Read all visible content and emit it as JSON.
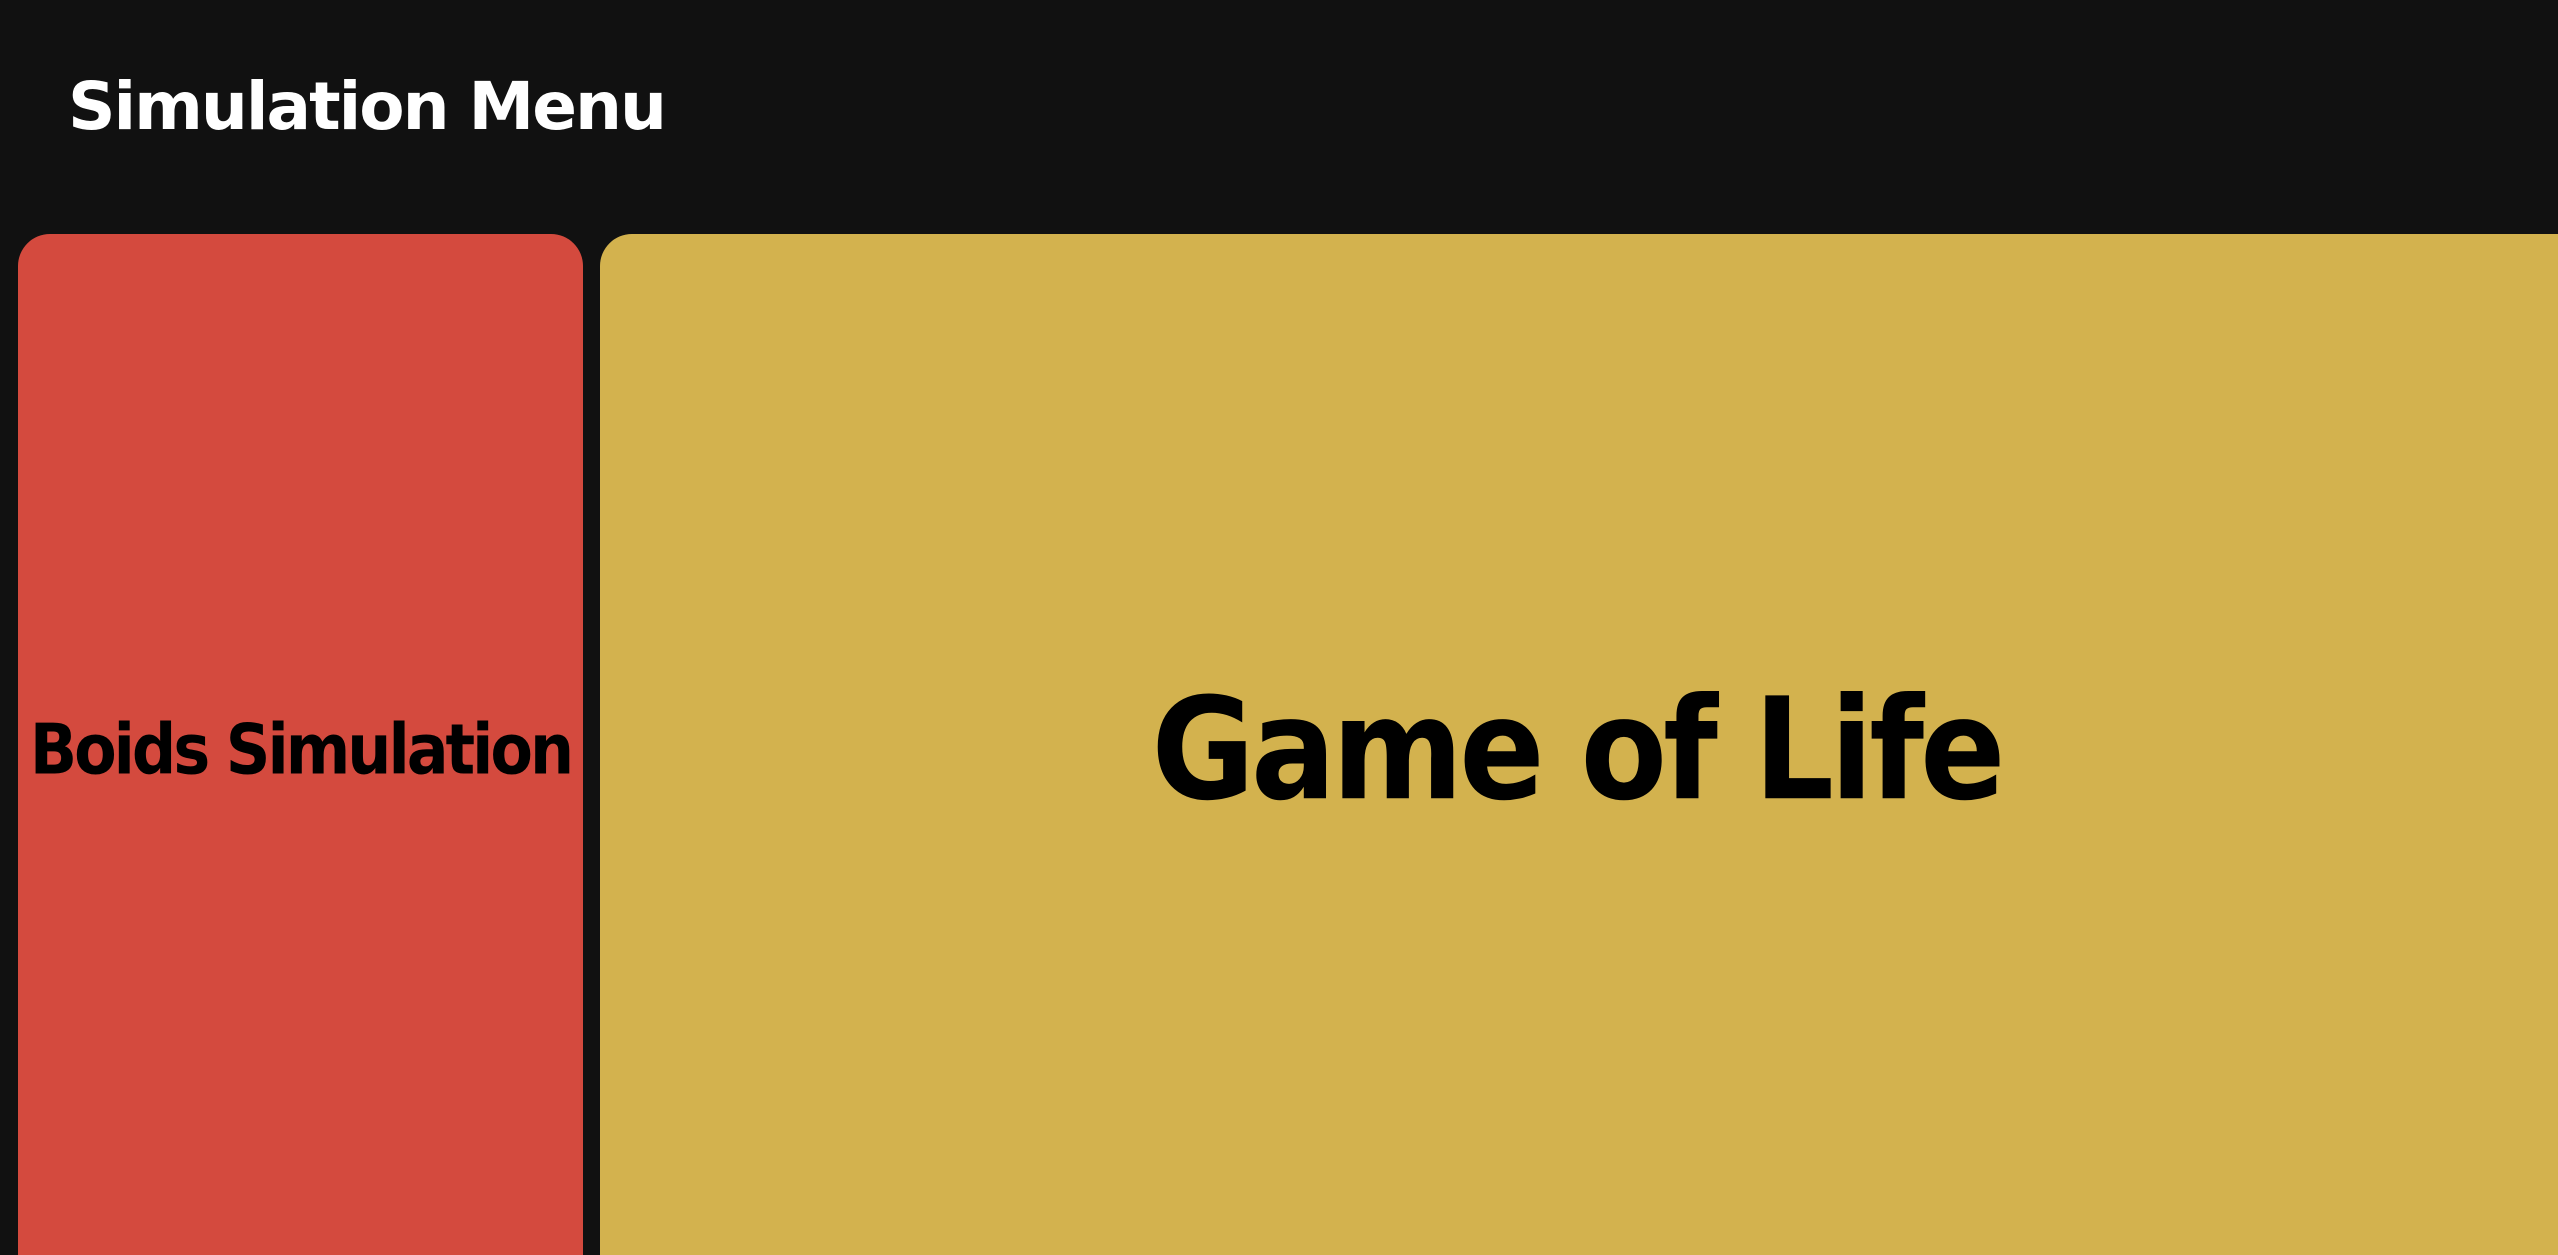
{
  "header": {
    "title": "Simulation Menu"
  },
  "simulations": [
    {
      "label": "Boids Simulation",
      "color": "#d44a3e"
    },
    {
      "label": "Game of Life",
      "color": "#d3b24e"
    }
  ],
  "theme": {
    "background": "#111111",
    "title_color": "#ffffff",
    "label_color": "#000000"
  }
}
